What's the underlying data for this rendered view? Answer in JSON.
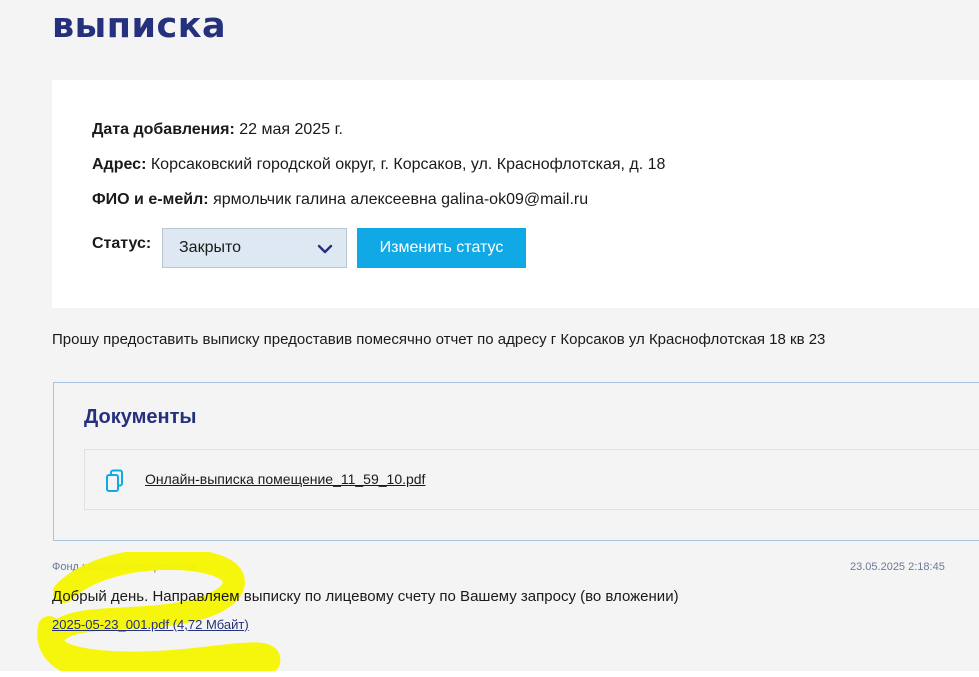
{
  "header": {
    "title": "выписка"
  },
  "info": {
    "date_label": "Дата добавления:",
    "date_value": "22 мая 2025 г.",
    "address_label": "Адрес:",
    "address_value": "Корсаковский городской округ, г. Корсаков, ул. Краснофлотская, д. 18",
    "fio_label": "ФИО и е-мейл:",
    "fio_value": "ярмольчик галина алексеевна galina-ok09@mail.ru",
    "status_label": "Статус:",
    "status_value": "Закрыто",
    "change_status_button": "Изменить статус"
  },
  "request_text": "Прошу предоставить выписку предоставив помесячно отчет по адресу г Корсаков ул Краснофлотская 18 кв 23",
  "documents": {
    "title": "Документы",
    "items": [
      {
        "icon": "copy-document-icon",
        "name": "Онлайн-выписка помещение_11_59_10.pdf"
      }
    ]
  },
  "message": {
    "author": "Фонд капитального ремонта",
    "date": "23.05.2025 2:18:45",
    "text": "Добрый день. Направляем выписку по лицевому счету по Вашему запросу (во вложении)",
    "attachment": "2025-05-23_001.pdf (4,72 Мбайт)"
  },
  "colors": {
    "accent_blue": "#25317c",
    "button_blue": "#11a8e6",
    "highlight_yellow": "#f5f500",
    "background": "#f4f4f4"
  }
}
